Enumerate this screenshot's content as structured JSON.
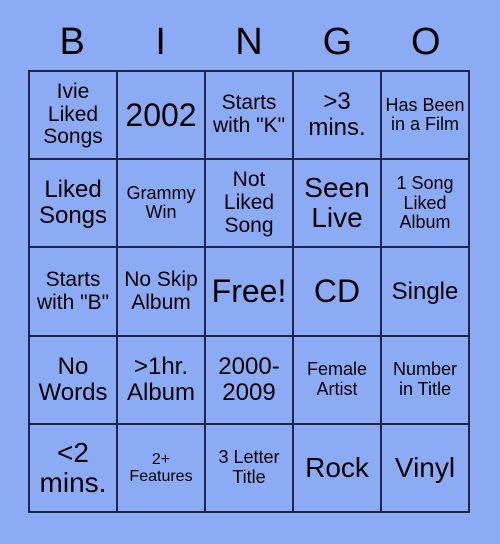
{
  "card": {
    "title": "Bingo Card",
    "background_color": "#8cabf5",
    "border_color": "#232642",
    "text_color": "#000000"
  },
  "header": {
    "letters": [
      "B",
      "I",
      "N",
      "G",
      "O"
    ]
  },
  "grid": {
    "columns": 5,
    "rows": 5,
    "free_space": {
      "row": 2,
      "col": 2,
      "label": "Free!"
    },
    "cells": [
      [
        {
          "text": "Ivie Liked Songs",
          "size": "sm"
        },
        {
          "text": "2002",
          "size": "xl"
        },
        {
          "text": "Starts with \"K\"",
          "size": "sm"
        },
        {
          "text": ">3 mins.",
          "size": "md"
        },
        {
          "text": "Has Been in a Film",
          "size": "xs"
        }
      ],
      [
        {
          "text": "Liked Songs",
          "size": "md"
        },
        {
          "text": "Grammy Win",
          "size": "xs"
        },
        {
          "text": "Not Liked Song",
          "size": "sm"
        },
        {
          "text": "Seen Live",
          "size": "lg"
        },
        {
          "text": "1 Song Liked Album",
          "size": "xs"
        }
      ],
      [
        {
          "text": "Starts with \"B\"",
          "size": "sm"
        },
        {
          "text": "No Skip Album",
          "size": "sm"
        },
        {
          "text": "Free!",
          "size": "xl"
        },
        {
          "text": "CD",
          "size": "xl"
        },
        {
          "text": "Single",
          "size": "md"
        }
      ],
      [
        {
          "text": "No Words",
          "size": "md"
        },
        {
          "text": ">1hr. Album",
          "size": "md"
        },
        {
          "text": "2000-2009",
          "size": "md"
        },
        {
          "text": "Female Artist",
          "size": "xs"
        },
        {
          "text": "Number in Title",
          "size": "xs"
        }
      ],
      [
        {
          "text": "<2 mins.",
          "size": "lg"
        },
        {
          "text": "2+ Features",
          "size": "xxs"
        },
        {
          "text": "3 Letter Title",
          "size": "xs"
        },
        {
          "text": "Rock",
          "size": "lg"
        },
        {
          "text": "Vinyl",
          "size": "lg"
        }
      ]
    ]
  }
}
